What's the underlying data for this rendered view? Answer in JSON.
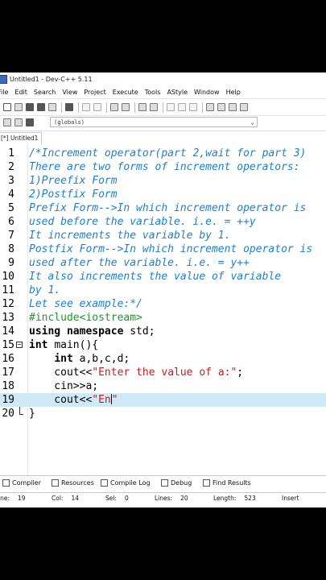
{
  "window": {
    "title": "Untitled1 - Dev-C++ 5.11"
  },
  "menu": [
    "File",
    "Edit",
    "Search",
    "View",
    "Project",
    "Execute",
    "Tools",
    "AStyle",
    "Window",
    "Help"
  ],
  "toolbar": {
    "globals_combo": "(globals)"
  },
  "editor_tab": "[*] Untitled1",
  "code_lines": [
    {
      "n": "1",
      "parts": [
        {
          "c": "cmt",
          "t": "/*Increment operator(part 2,wait for part 3)"
        }
      ]
    },
    {
      "n": "2",
      "parts": [
        {
          "c": "cmt",
          "t": "There are two forms of increment operators:"
        }
      ]
    },
    {
      "n": "3",
      "parts": [
        {
          "c": "cmt",
          "t": "1)Preefix Form"
        }
      ]
    },
    {
      "n": "4",
      "parts": [
        {
          "c": "cmt",
          "t": "2)Postfix Form"
        }
      ]
    },
    {
      "n": "5",
      "parts": [
        {
          "c": "cmt",
          "t": "Prefix Form-->In which increment operator is"
        }
      ]
    },
    {
      "n": "6",
      "parts": [
        {
          "c": "cmt",
          "t": "used before the variable. i.e. = ++y"
        }
      ]
    },
    {
      "n": "7",
      "parts": [
        {
          "c": "cmt",
          "t": "It increments the variable by 1."
        }
      ]
    },
    {
      "n": "8",
      "parts": [
        {
          "c": "cmt",
          "t": "Postfix Form-->In which increment operator is"
        }
      ]
    },
    {
      "n": "9",
      "parts": [
        {
          "c": "cmt",
          "t": "used after the variable. i.e. = y++"
        }
      ]
    },
    {
      "n": "10",
      "parts": [
        {
          "c": "cmt",
          "t": "It also increments the value of variable"
        }
      ]
    },
    {
      "n": "11",
      "parts": [
        {
          "c": "cmt",
          "t": "by 1."
        }
      ]
    },
    {
      "n": "12",
      "parts": [
        {
          "c": "cmt",
          "t": "Let see example:*/"
        }
      ]
    },
    {
      "n": "13",
      "parts": [
        {
          "c": "pp",
          "t": "#include<iostream>"
        }
      ]
    },
    {
      "n": "14",
      "parts": [
        {
          "c": "kw",
          "t": "using namespace "
        },
        {
          "c": "tx",
          "t": "std;"
        }
      ]
    },
    {
      "n": "15",
      "fold": "start",
      "parts": [
        {
          "c": "kw",
          "t": "int "
        },
        {
          "c": "tx",
          "t": "main(){"
        }
      ]
    },
    {
      "n": "16",
      "parts": [
        {
          "c": "tx",
          "t": "    "
        },
        {
          "c": "kw",
          "t": "int "
        },
        {
          "c": "tx",
          "t": "a,b,c,d;"
        }
      ]
    },
    {
      "n": "17",
      "parts": [
        {
          "c": "tx",
          "t": "    cout<<"
        },
        {
          "c": "str",
          "t": "\"Enter the value of a:\""
        },
        {
          "c": "tx",
          "t": ";"
        }
      ]
    },
    {
      "n": "18",
      "parts": [
        {
          "c": "tx",
          "t": "    cin>>a;"
        }
      ]
    },
    {
      "n": "19",
      "active": true,
      "parts": [
        {
          "c": "tx",
          "t": "    cout<<"
        },
        {
          "c": "str",
          "t": "\"En"
        },
        {
          "c": "cursor",
          "t": ""
        },
        {
          "c": "str",
          "t": "\""
        }
      ]
    },
    {
      "n": "20",
      "fold": "end",
      "parts": [
        {
          "c": "tx",
          "t": "}"
        }
      ]
    }
  ],
  "bottom_tabs": [
    "Compiler",
    "Resources",
    "Compile Log",
    "Debug",
    "Find Results"
  ],
  "status": {
    "line_label": "ine:",
    "line": "19",
    "col_label": "Col:",
    "col": "14",
    "sel_label": "Sel:",
    "sel": "0",
    "lines_label": "Lines:",
    "lines": "20",
    "length_label": "Length:",
    "length": "523",
    "mode": "Insert"
  }
}
